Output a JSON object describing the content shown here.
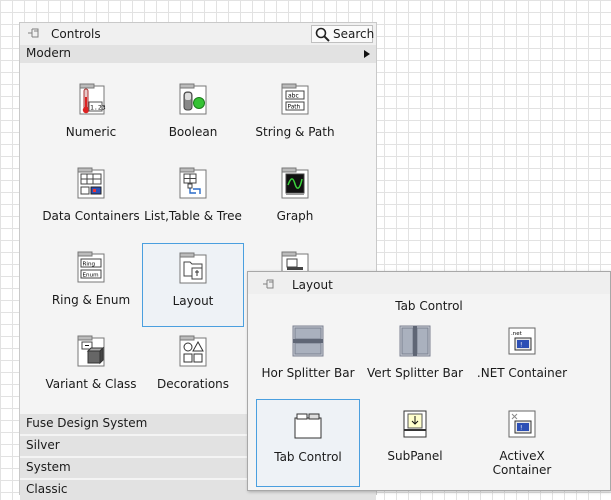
{
  "controls_palette": {
    "title": "Controls",
    "search_label": "Search",
    "category": "Modern",
    "items": [
      {
        "label": "Numeric",
        "icon": "numeric-icon"
      },
      {
        "label": "Boolean",
        "icon": "boolean-icon"
      },
      {
        "label": "String & Path",
        "icon": "string-path-icon"
      },
      {
        "label": "Data Containers",
        "icon": "data-containers-icon"
      },
      {
        "label": "List,Table & Tree",
        "icon": "list-table-tree-icon"
      },
      {
        "label": "Graph",
        "icon": "graph-icon"
      },
      {
        "label": "Ring & Enum",
        "icon": "ring-enum-icon"
      },
      {
        "label": "Layout",
        "icon": "layout-icon"
      },
      {
        "label": "",
        "icon": "containers-icon"
      },
      {
        "label": "Variant & Class",
        "icon": "variant-class-icon"
      },
      {
        "label": "Decorations",
        "icon": "decorations-icon"
      }
    ],
    "categories": [
      "Fuse Design System",
      "Silver",
      "System",
      "Classic"
    ]
  },
  "layout_palette": {
    "title": "Layout",
    "caption": "Tab Control",
    "items": [
      {
        "label": "Hor Splitter Bar",
        "icon": "hor-splitter-icon"
      },
      {
        "label": "Vert Splitter Bar",
        "icon": "vert-splitter-icon"
      },
      {
        "label": ".NET Container",
        "icon": "dotnet-container-icon"
      },
      {
        "label": "Tab Control",
        "icon": "tab-control-icon"
      },
      {
        "label": "SubPanel",
        "icon": "subpanel-icon"
      },
      {
        "label": "ActiveX Container",
        "icon": "activex-container-icon"
      }
    ]
  },
  "colors": {
    "selection_border": "#4a9fdf",
    "palette_bg": "#f4f4f4",
    "grid_line": "#e2e2e2"
  }
}
